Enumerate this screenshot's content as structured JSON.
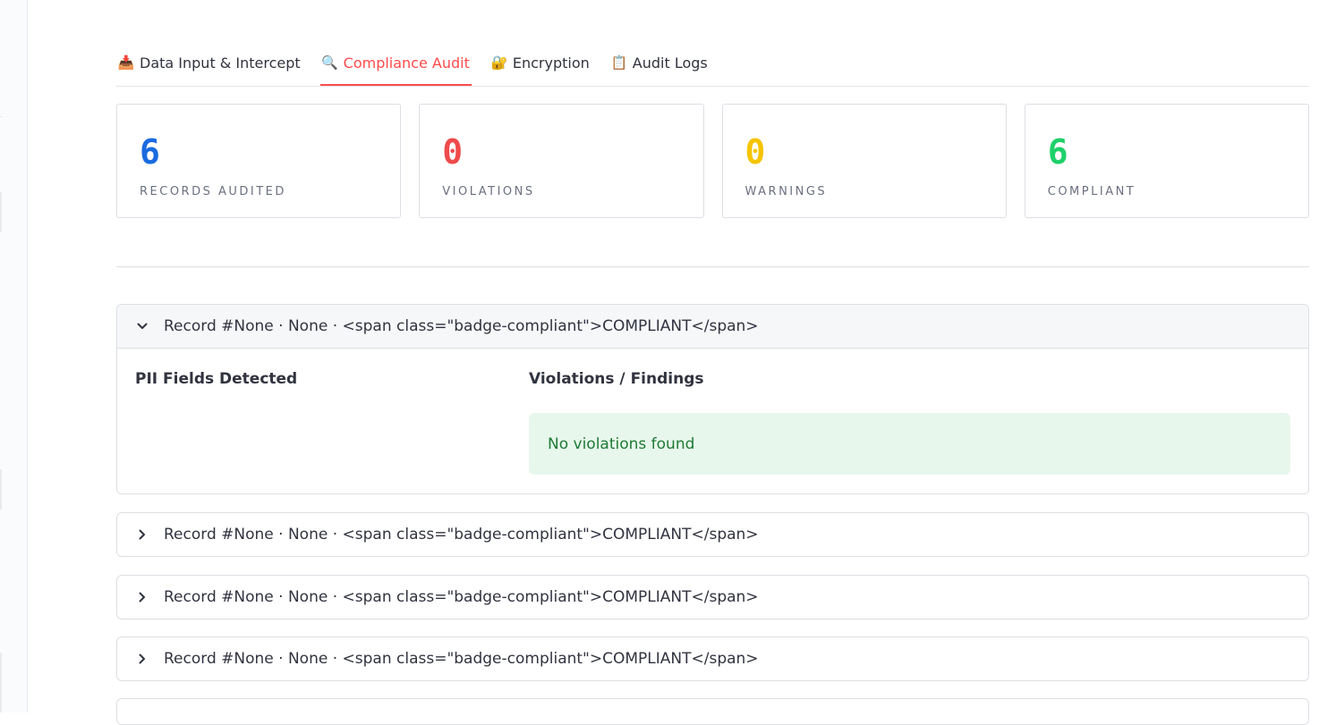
{
  "tabs": [
    {
      "icon": "inbox-tray-icon",
      "glyph": "📥",
      "label": "Data Input & Intercept"
    },
    {
      "icon": "magnifier-icon",
      "glyph": "🔍",
      "label": "Compliance Audit"
    },
    {
      "icon": "lock-icon",
      "glyph": "🔐",
      "label": "Encryption"
    },
    {
      "icon": "clipboard-icon",
      "glyph": "📋",
      "label": "Audit Logs"
    }
  ],
  "metrics": [
    {
      "value": "6",
      "label": "RECORDS AUDITED",
      "color": "#1a6be0"
    },
    {
      "value": "0",
      "label": "VIOLATIONS",
      "color": "#ef4b4b"
    },
    {
      "value": "0",
      "label": "WARNINGS",
      "color": "#f5c400"
    },
    {
      "value": "6",
      "label": "COMPLIANT",
      "color": "#1fd16a"
    }
  ],
  "records": [
    {
      "title": "Record #None · None · <span class=\"badge-compliant\">COMPLIANT</span>",
      "expanded": true
    },
    {
      "title": "Record #None · None · <span class=\"badge-compliant\">COMPLIANT</span>",
      "expanded": false
    },
    {
      "title": "Record #None · None · <span class=\"badge-compliant\">COMPLIANT</span>",
      "expanded": false
    },
    {
      "title": "Record #None · None · <span class=\"badge-compliant\">COMPLIANT</span>",
      "expanded": false
    }
  ],
  "detail": {
    "pii_title": "PII Fields Detected",
    "violations_title": "Violations / Findings",
    "no_violations": "No violations found"
  }
}
